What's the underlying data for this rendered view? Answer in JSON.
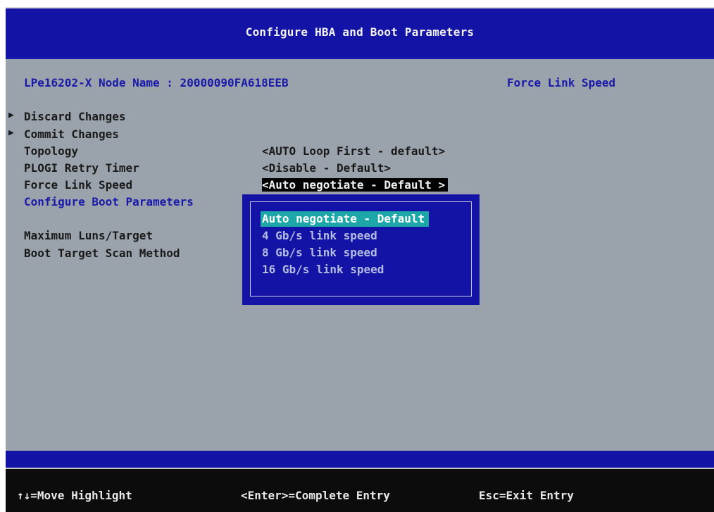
{
  "title": "Configure HBA and Boot Parameters",
  "node_name": "LPe16202-X Node Name : 20000090FA618EEB",
  "help_title": "Force Link Speed",
  "menu": {
    "discard": "Discard Changes",
    "commit": "Commit  Changes",
    "topology": "Topology",
    "plogi": "PLOGI Retry Timer",
    "link_speed": "Force Link Speed",
    "boot_params": "Configure Boot Parameters",
    "max_luns": "Maximum Luns/Target",
    "scan_method": "Boot Target Scan Method"
  },
  "values": {
    "topology": "<AUTO Loop First - default>",
    "plogi": "<Disable - Default>",
    "link_speed": "<Auto negotiate - Default >"
  },
  "popup": {
    "options": [
      "Auto negotiate - Default",
      "4 Gb/s link speed",
      "8 Gb/s link speed",
      "16 Gb/s link speed"
    ],
    "selected_index": 0
  },
  "status": {
    "move": "↑↓=Move Highlight",
    "enter": "<Enter>=Complete Entry",
    "esc": "Esc=Exit Entry"
  },
  "colors": {
    "header_blue": "#1314a5",
    "panel_gray": "#9aa2ab",
    "link_blue": "#1a1aa8",
    "highlight_teal": "#1ea7a9"
  }
}
